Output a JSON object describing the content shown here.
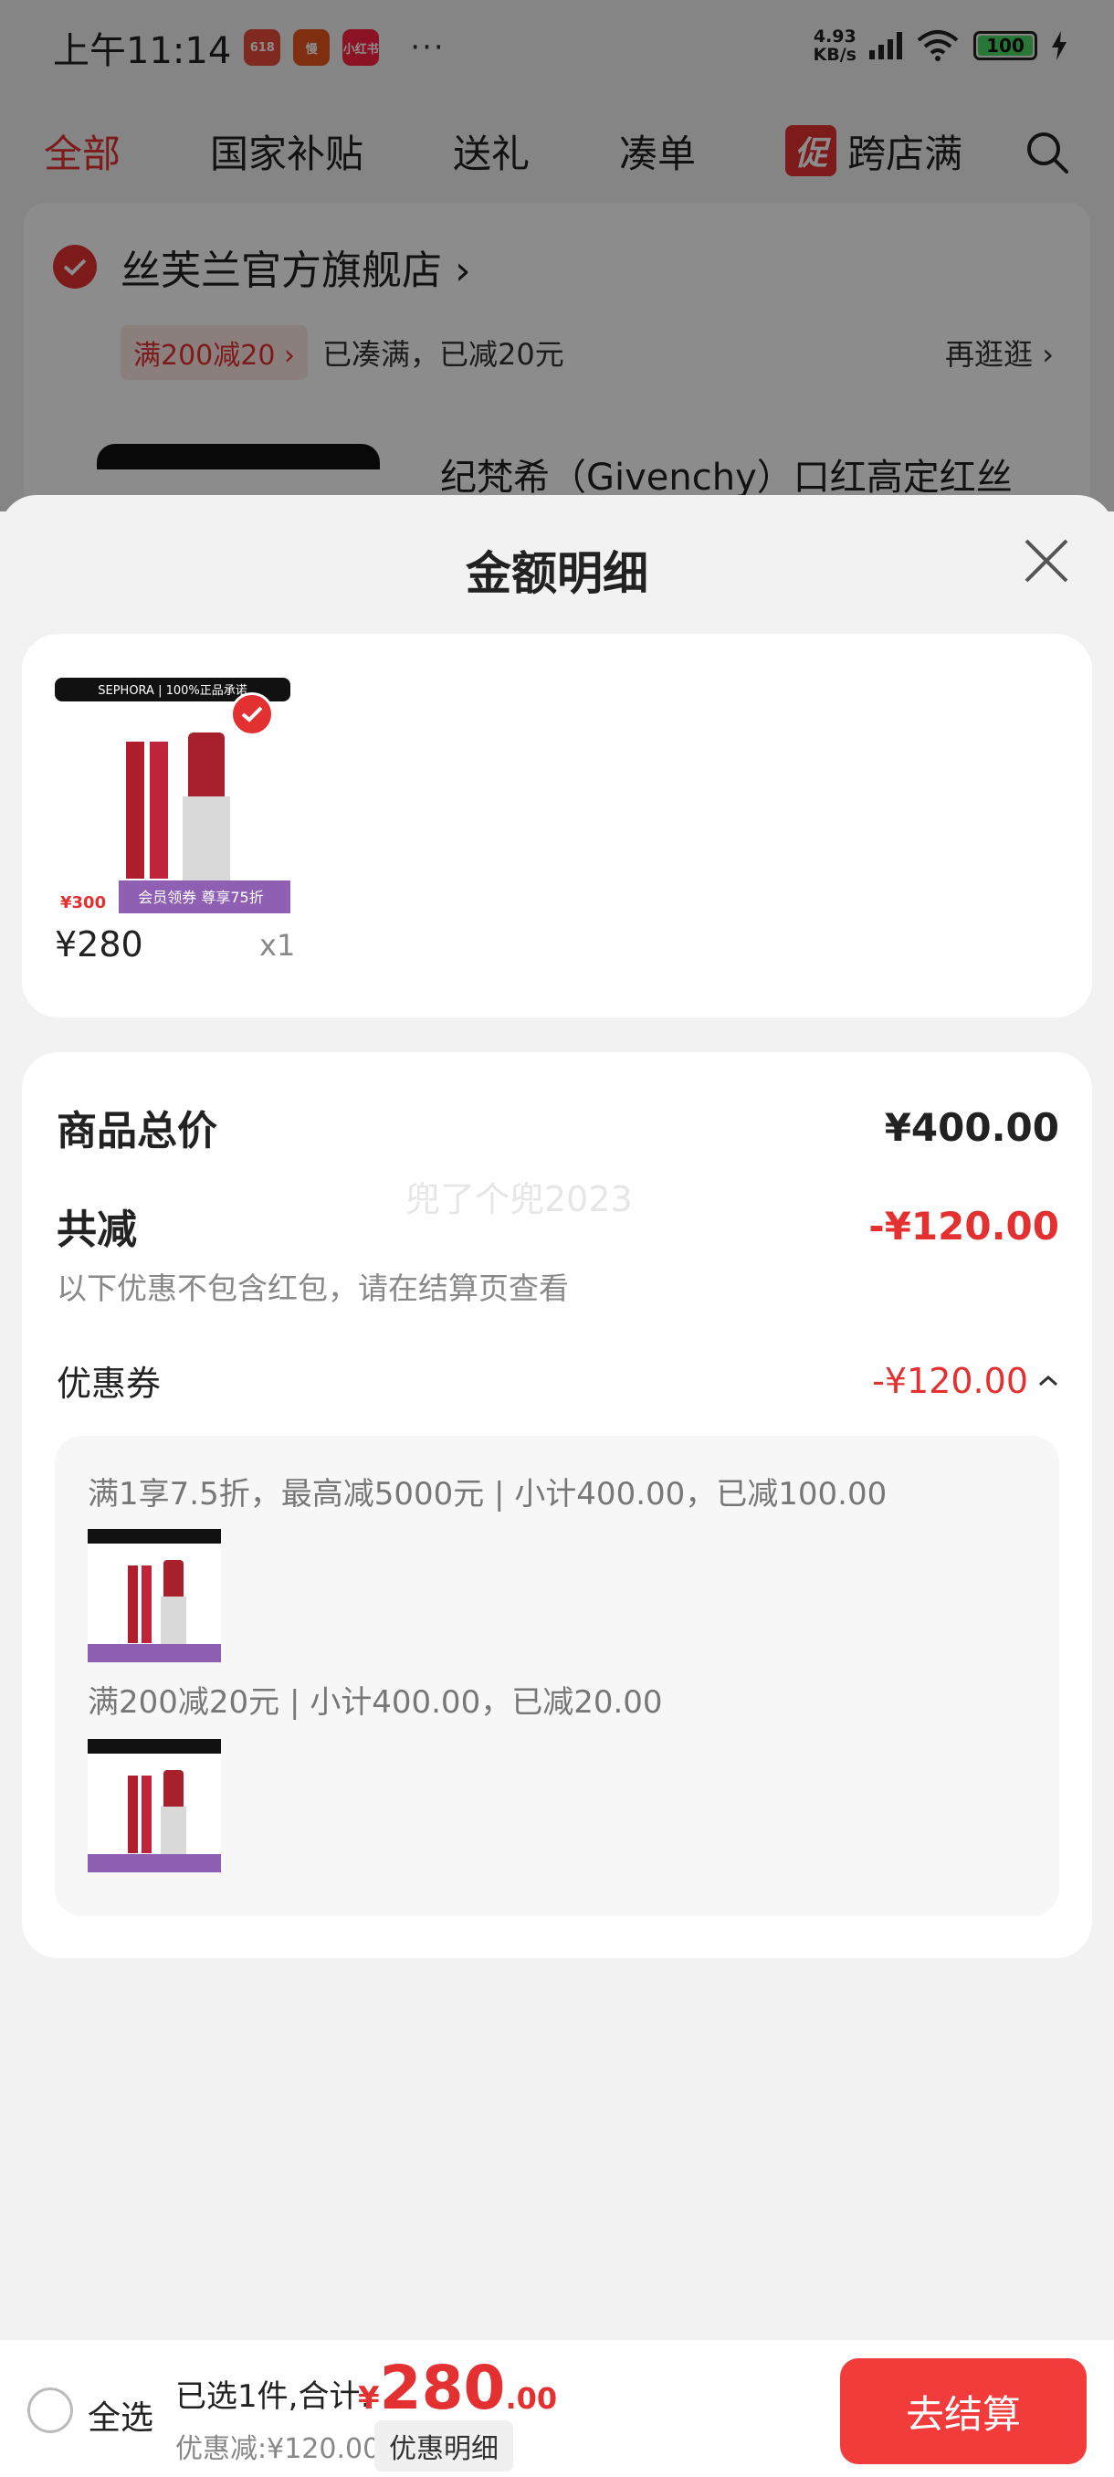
{
  "status_bar": {
    "time": "上午11:14",
    "apps": [
      {
        "label": "618",
        "color": "#e74c3c"
      },
      {
        "label": "慢",
        "color": "#e8541e"
      },
      {
        "label": "小红书",
        "color": "#ff2442"
      }
    ],
    "more": "···",
    "net_speed": "4.93",
    "net_unit": "KB/s",
    "battery": "100"
  },
  "tabs": [
    {
      "label": "全部",
      "active": true
    },
    {
      "label": "国家补贴"
    },
    {
      "label": "送礼"
    },
    {
      "label": "凑单"
    }
  ],
  "promo_tab": {
    "tag": "促",
    "label": "跨店满"
  },
  "store": {
    "name": "丝芙兰官方旗舰店 ›",
    "promo_chip": "满200减20 ›",
    "promo_text": "已凑满，已减20元",
    "more_link": "再逛逛 ›",
    "product_title": "纪梵希（Givenchy）口红高定红丝"
  },
  "sheet": {
    "title": "金额明细",
    "item": {
      "brand_bar": "SEPHORA  |  100%正品承诺",
      "badge_price": "¥300",
      "badge_text": "会员领券 尊享75折",
      "price": "¥280",
      "qty": "x1"
    },
    "summary": {
      "total_label": "商品总价",
      "total_value": "¥400.00",
      "discount_label": "共减",
      "discount_value": "-¥120.00",
      "hint": "以下优惠不包含红包，请在结算页查看",
      "watermark": "兜了个兜2023",
      "coupon_label": "优惠券",
      "coupon_value": "-¥120.00",
      "coupon_lines": [
        "满1享7.5折，最高减5000元 | 小计400.00，已减100.00",
        "满200减20元 | 小计400.00，已减20.00"
      ]
    }
  },
  "bottom": {
    "select_all": "全选",
    "selected": "已选1件,合计:",
    "currency": "¥",
    "total_int": "280",
    "total_dec": ".00",
    "discount": "优惠减:¥120.00",
    "detail_btn": "优惠明细",
    "checkout": "去结算"
  },
  "colors": {
    "accent": "#e33030",
    "checkout": "#f23b3b"
  }
}
